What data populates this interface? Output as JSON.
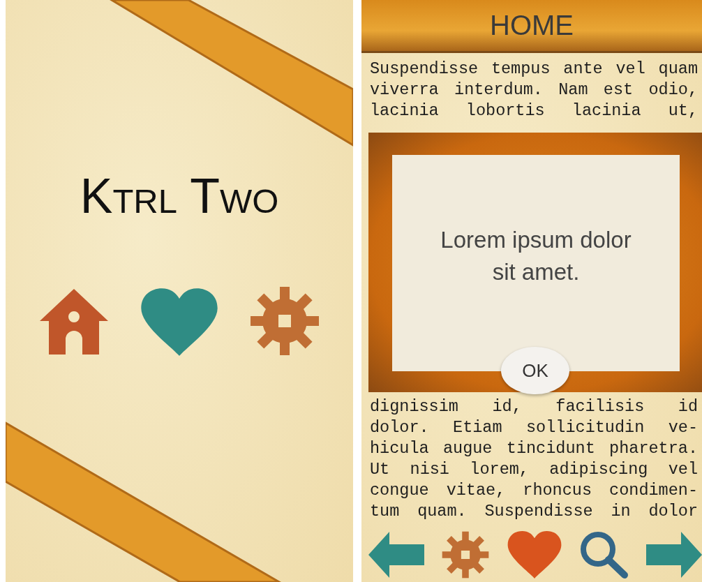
{
  "home_screen": {
    "title": "Ktrl Two"
  },
  "content_screen": {
    "header": "HOME",
    "text_above": [
      "Suspendisse tempus ante vel quam",
      "viverra interdum. Nam est odio,",
      "lacinia lobortis lacinia ut,"
    ],
    "text_below": [
      "dignissim id, facilisis id",
      "dolor. Etiam sollicitudin ve-",
      "hicula augue tincidunt pharetra.",
      "Ut nisi lorem, adipiscing vel",
      "congue vitae, rhoncus condimen-",
      "tum quam. Suspendisse in dolor"
    ],
    "dialog": {
      "message": "Lorem ipsum dolor sit amet.",
      "button": "OK"
    }
  }
}
